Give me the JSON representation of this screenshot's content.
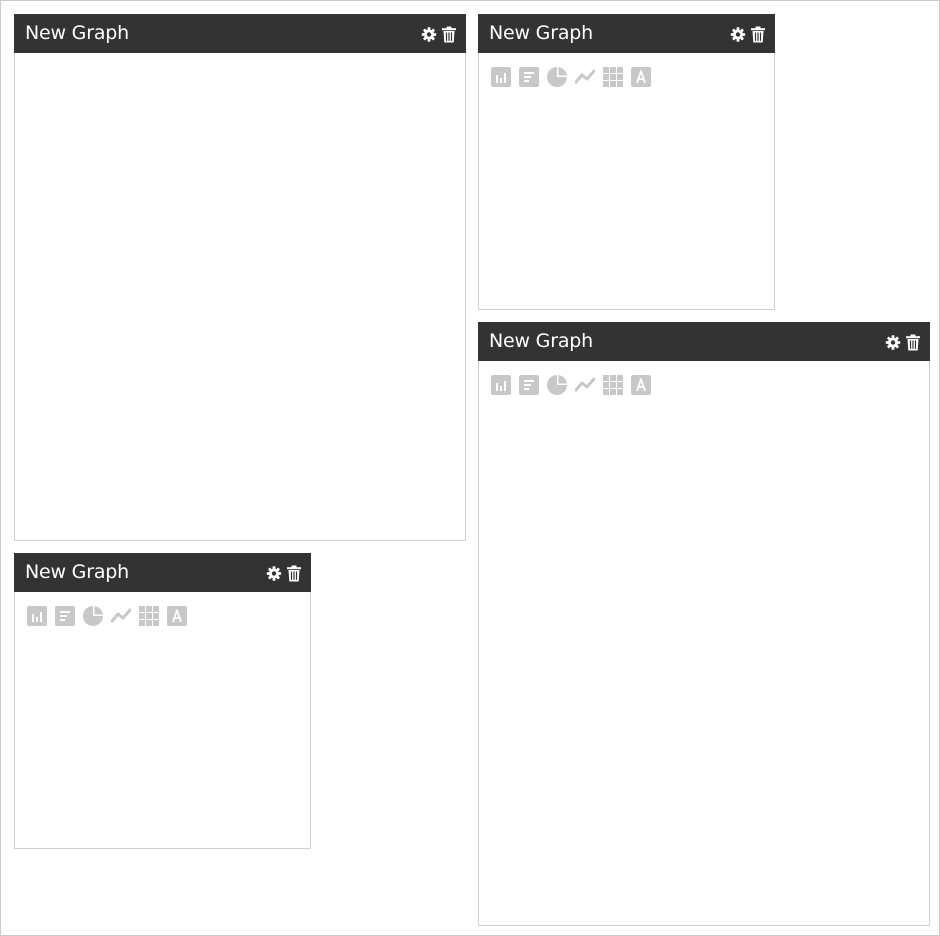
{
  "colors": {
    "header_bg": "#333333",
    "header_text": "#ffffff",
    "icon_gray": "#c8c8c8",
    "border": "#cfcfcf"
  },
  "widgets": [
    {
      "title": "New Graph",
      "toolbar_visible": false
    },
    {
      "title": "New Graph",
      "toolbar_visible": true
    },
    {
      "title": "New Graph",
      "toolbar_visible": true
    },
    {
      "title": "New Graph",
      "toolbar_visible": true
    }
  ],
  "header_icons": [
    "gear-icon",
    "trash-icon"
  ],
  "toolbar_icons": [
    "bar-chart-icon",
    "horizontal-bar-chart-icon",
    "pie-chart-icon",
    "line-chart-icon",
    "table-icon",
    "text-icon"
  ]
}
